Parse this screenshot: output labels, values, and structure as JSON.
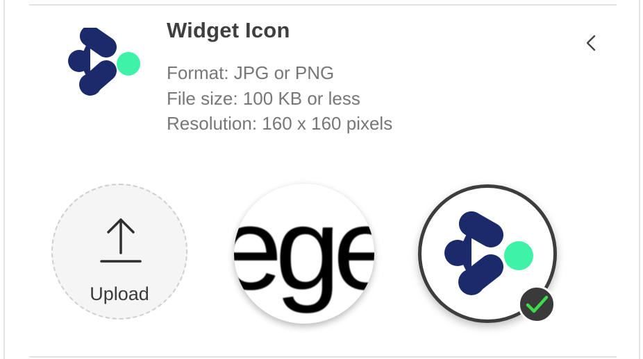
{
  "widget": {
    "title": "Widget Icon",
    "specs": {
      "format": "Format: JPG or PNG",
      "file_size": "File size: 100 KB or less",
      "resolution": "Resolution: 160 x 160 pixels"
    }
  },
  "upload": {
    "label": "Upload"
  },
  "options": [
    {
      "name": "text-image-option",
      "text": "ege",
      "selected": false
    },
    {
      "name": "brand-logo-option",
      "selected": true
    }
  ],
  "icons": {
    "collapse": "chevron-left-icon",
    "upload": "upload-arrow-icon",
    "selected": "checkmark-icon"
  },
  "colors": {
    "logo_navy": "#1b2a6b",
    "logo_mint": "#3ef2a8",
    "check_green": "#3ddc4c",
    "badge_dark": "#3a3a3a",
    "title": "#3f3f3f",
    "spec_text": "#777777"
  }
}
